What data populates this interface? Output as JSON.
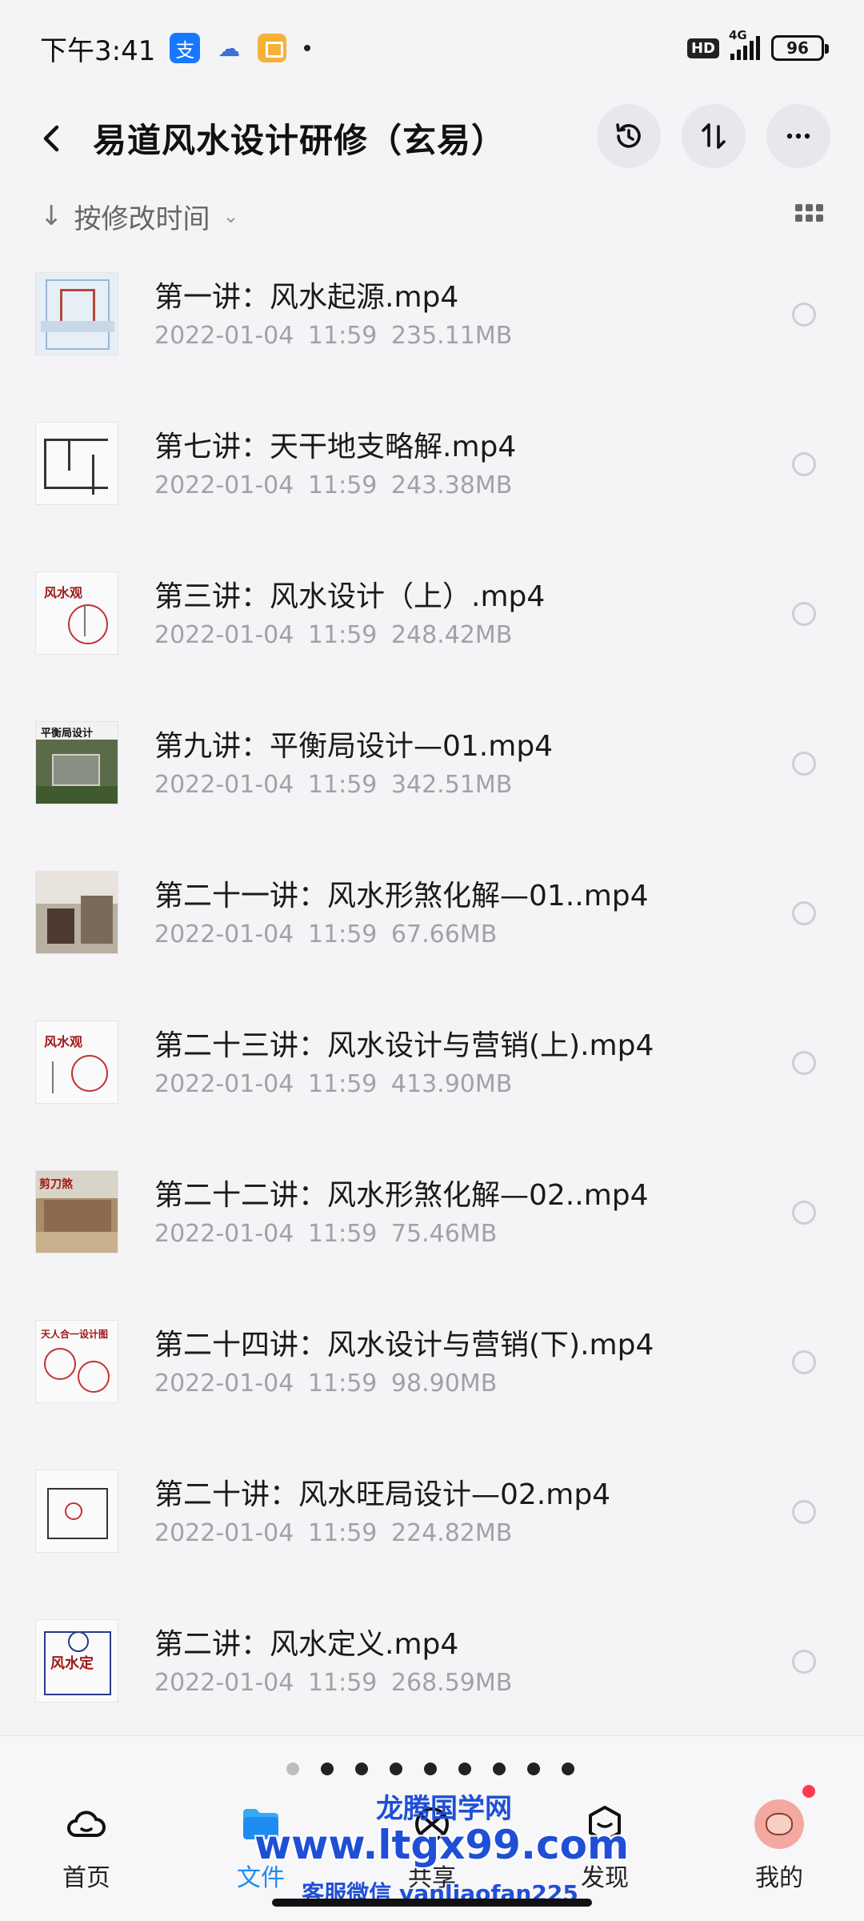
{
  "status_bar": {
    "time": "下午3:41",
    "alipay_glyph": "支",
    "hd_label": "HD",
    "network_label": "4G",
    "battery_level": "96"
  },
  "header": {
    "title": "易道风水设计研修（玄易）"
  },
  "sort": {
    "label": "按修改时间"
  },
  "files": [
    {
      "name": "第一讲：风水起源.mp4",
      "date": "2022-01-04",
      "time": "11:59",
      "size": "235.11MB"
    },
    {
      "name": "第七讲：天干地支略解.mp4",
      "date": "2022-01-04",
      "time": "11:59",
      "size": "243.38MB"
    },
    {
      "name": "第三讲：风水设计（上）.mp4",
      "date": "2022-01-04",
      "time": "11:59",
      "size": "248.42MB"
    },
    {
      "name": "第九讲：平衡局设计—01.mp4",
      "date": "2022-01-04",
      "time": "11:59",
      "size": "342.51MB"
    },
    {
      "name": "第二十一讲：风水形煞化解—01..mp4",
      "date": "2022-01-04",
      "time": "11:59",
      "size": "67.66MB"
    },
    {
      "name": "第二十三讲：风水设计与营销(上).mp4",
      "date": "2022-01-04",
      "time": "11:59",
      "size": "413.90MB"
    },
    {
      "name": "第二十二讲：风水形煞化解—02..mp4",
      "date": "2022-01-04",
      "time": "11:59",
      "size": "75.46MB"
    },
    {
      "name": "第二十四讲：风水设计与营销(下).mp4",
      "date": "2022-01-04",
      "time": "11:59",
      "size": "98.90MB"
    },
    {
      "name": "第二十讲：风水旺局设计—02.mp4",
      "date": "2022-01-04",
      "time": "11:59",
      "size": "224.82MB"
    },
    {
      "name": "第二讲：风水定义.mp4",
      "date": "2022-01-04",
      "time": "11:59",
      "size": "268.59MB"
    }
  ],
  "thumbnails": {
    "t1": "",
    "t3": "风水观",
    "t4": "平衡局设计",
    "t6": "风水观",
    "t7": "剪刀煞",
    "t8": "天人合一设计图",
    "t10": "风水定"
  },
  "bottom_nav": {
    "items": [
      {
        "label": "首页",
        "icon": "home-cloud-icon",
        "active": false
      },
      {
        "label": "文件",
        "icon": "folder-icon",
        "active": true
      },
      {
        "label": "共享",
        "icon": "share-icon",
        "active": false
      },
      {
        "label": "发现",
        "icon": "discover-icon",
        "active": false
      },
      {
        "label": "我的",
        "icon": "avatar-icon",
        "active": false
      }
    ]
  },
  "watermark": {
    "line1": "龙腾国学网",
    "line2": "www.ltgx99.com",
    "line3": "客服微信 yanliaofan225"
  },
  "colors": {
    "accent": "#1e8cf0",
    "watermark": "#1f4fd6",
    "notification": "#ff3b4f"
  }
}
